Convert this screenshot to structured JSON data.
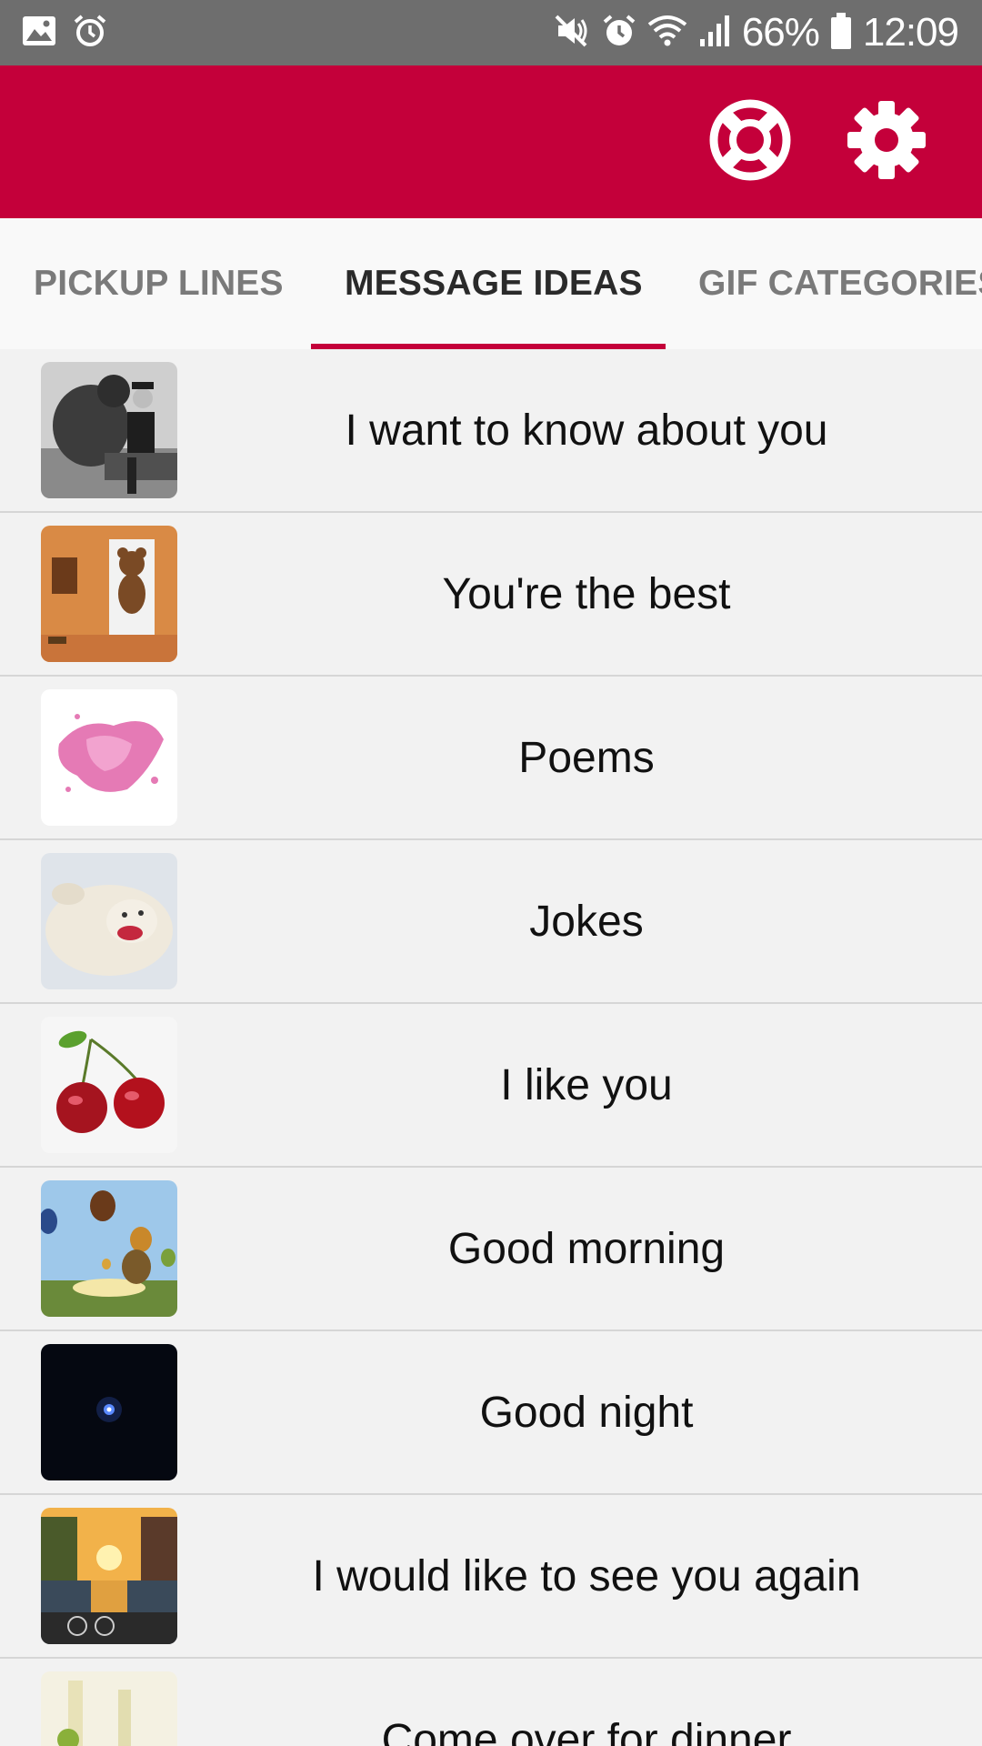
{
  "status_bar": {
    "battery": "66%",
    "time": "12:09",
    "icons": [
      "gallery-icon",
      "alarm-icon",
      "mute-icon",
      "alarm-icon",
      "wifi-icon",
      "signal-icon",
      "battery-icon"
    ]
  },
  "app_bar": {
    "color": "#c4003a",
    "actions": [
      "lifebuoy-icon",
      "gear-icon"
    ]
  },
  "tabs": [
    {
      "label": "PICKUP LINES",
      "active": false
    },
    {
      "label": "MESSAGE IDEAS",
      "active": true
    },
    {
      "label": "GIF CATEGORIES",
      "active": false
    }
  ],
  "list": [
    {
      "label": "I want to know about you",
      "thumb": "bear-photo"
    },
    {
      "label": "You're the best",
      "thumb": "teddy-bear-photo"
    },
    {
      "label": "Poems",
      "thumb": "pink-powder-photo"
    },
    {
      "label": "Jokes",
      "thumb": "seal-photo"
    },
    {
      "label": "I like you",
      "thumb": "cherries-photo"
    },
    {
      "label": "Good morning",
      "thumb": "balloons-photo"
    },
    {
      "label": "Good night",
      "thumb": "star-photo"
    },
    {
      "label": "I would like to see you again",
      "thumb": "canal-sunset-photo"
    },
    {
      "label": "Come over for dinner",
      "thumb": "wine-glasses-photo"
    }
  ]
}
